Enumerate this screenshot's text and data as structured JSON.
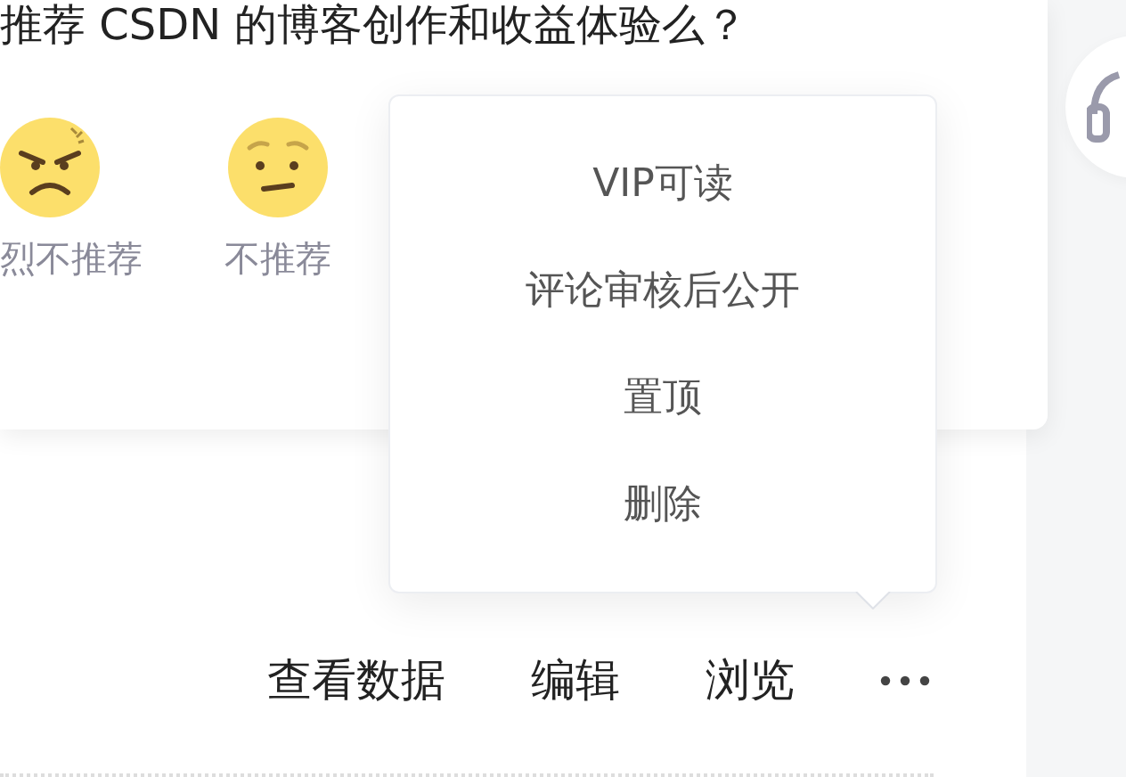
{
  "survey": {
    "question": "推荐 CSDN 的博客创作和收益体验么？",
    "options": [
      {
        "kind": "angry",
        "label": "烈不推荐"
      },
      {
        "kind": "uneasy",
        "label": "不推荐"
      }
    ]
  },
  "more_menu": {
    "expanded": true,
    "items": [
      "VIP可读",
      "评论审核后公开",
      "置顶",
      "删除"
    ]
  },
  "actions": [
    "查看数据",
    "编辑",
    "浏览"
  ]
}
